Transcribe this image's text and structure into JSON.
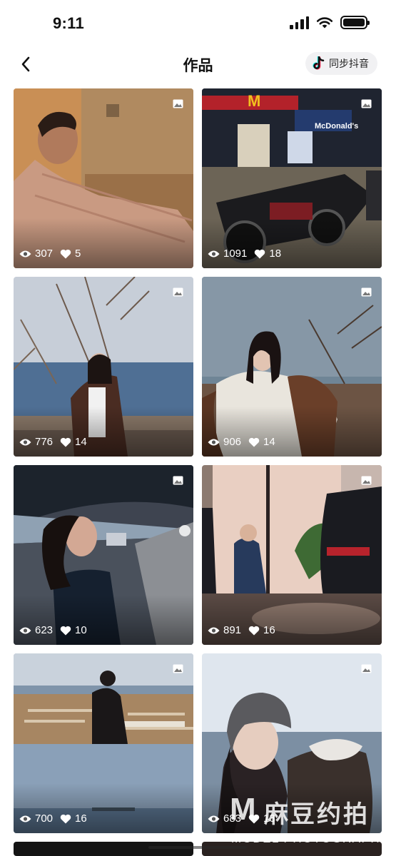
{
  "status_bar": {
    "time": "9:11"
  },
  "header": {
    "title": "作品",
    "sync_label": "同步抖音"
  },
  "works": [
    {
      "views": "307",
      "likes": "5"
    },
    {
      "views": "1091",
      "likes": "18",
      "sign_text": "McDonald's"
    },
    {
      "views": "776",
      "likes": "14"
    },
    {
      "views": "906",
      "likes": "14"
    },
    {
      "views": "623",
      "likes": "10"
    },
    {
      "views": "891",
      "likes": "16"
    },
    {
      "views": "700",
      "likes": "16"
    },
    {
      "views": "683",
      "likes": "13"
    }
  ],
  "watermark": {
    "cn": "麻豆约拍",
    "en": "MODEL PHOTOGRAPHY"
  },
  "icons": {
    "back": "chevron-left-icon",
    "sync": "tiktok-logo-icon",
    "views": "eye-icon",
    "likes": "heart-icon",
    "badge": "image-icon"
  },
  "colors": {
    "background": "#ffffff",
    "sync_button_bg": "#f1f1f3",
    "text": "#111111"
  }
}
